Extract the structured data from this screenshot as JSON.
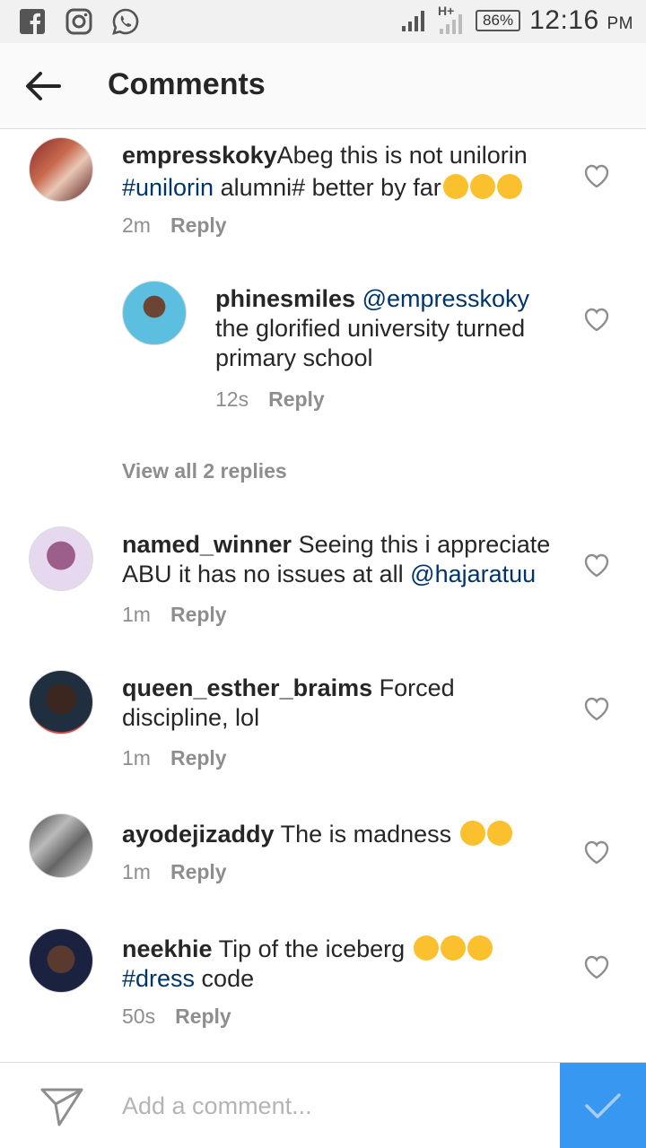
{
  "status_bar": {
    "network": "H+",
    "battery": "86%",
    "time": "12:16",
    "ampm": "PM",
    "icons": [
      "facebook-icon",
      "instagram-icon",
      "whatsapp-icon",
      "signal-icon",
      "battery-icon"
    ]
  },
  "header": {
    "title": "Comments",
    "back_icon": "arrow-left-icon"
  },
  "comments": [
    {
      "username": "empresskoky",
      "text_1": "Abeg this is not unilorin ",
      "tag_1": "#unilorin",
      "text_2": " alumni# better by far",
      "time": "2m",
      "reply_label": "Reply"
    },
    {
      "username": "phinesmiles",
      "mention": "@empresskoky",
      "text": " the glorified university turned primary school",
      "time": "12s",
      "reply_label": "Reply"
    },
    {
      "username": "named_winner",
      "text": " Seeing this i appreciate ABU it has no issues at all ",
      "mention": "@hajaratuu",
      "time": "1m",
      "reply_label": "Reply"
    },
    {
      "username": "queen_esther_braims",
      "text": " Forced discipline, lol",
      "time": "1m",
      "reply_label": "Reply"
    },
    {
      "username": "ayodejizaddy",
      "text": " The is madness ",
      "time": "1m",
      "reply_label": "Reply"
    },
    {
      "username": "neekhie",
      "text_1": " Tip of the iceberg ",
      "tag_1": "#dress",
      "text_2": " code",
      "time": "50s",
      "reply_label": "Reply"
    }
  ],
  "view_replies_label": "View all 2 replies",
  "composer": {
    "placeholder": "Add a comment..."
  },
  "colors": {
    "accent": "#3897f0",
    "link": "#003569",
    "muted": "#8e8e8e"
  }
}
